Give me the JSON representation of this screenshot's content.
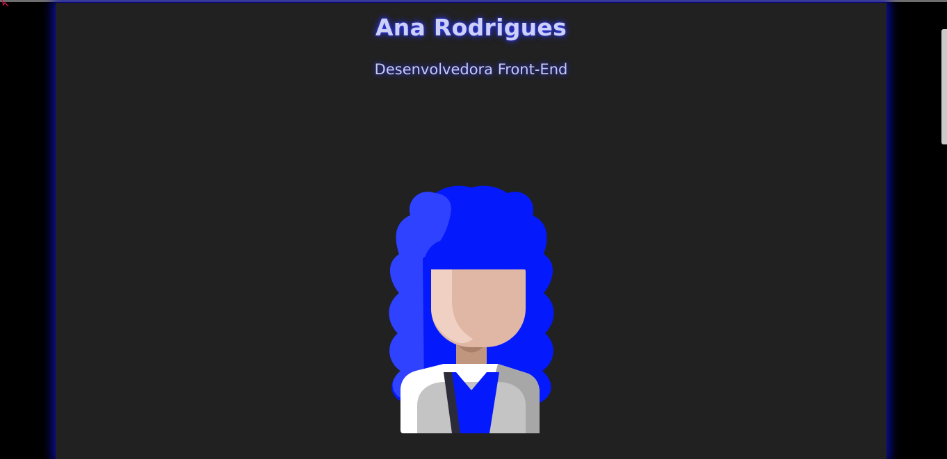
{
  "profile": {
    "name": "Ana Rodrigues",
    "role": "Desenvolvedora Front-End"
  },
  "avatar": {
    "icon": "woman-developer-avatar-icon",
    "hair_color": "#0419fc",
    "skin_color": "#e0b7a5"
  },
  "colors": {
    "background": "#000000",
    "card": "#212121",
    "glow": "#0c10b8",
    "text": "#cdd0f7"
  }
}
